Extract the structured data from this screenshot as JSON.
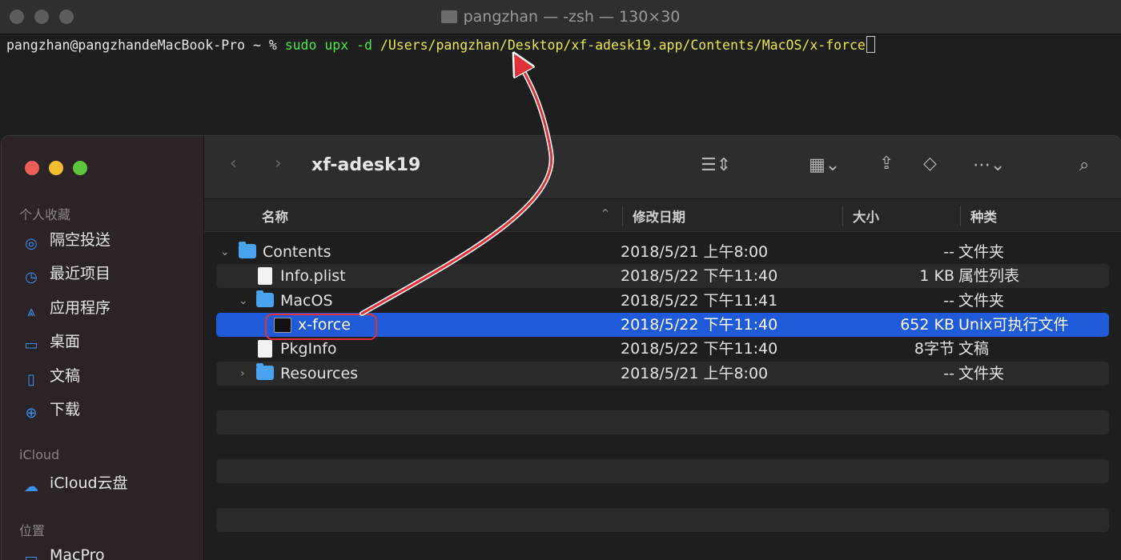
{
  "terminal": {
    "title": "pangzhan — -zsh — 130×30",
    "prompt": "pangzhan@pangzhandeMacBook-Pro ~ % ",
    "command": "sudo upx -d",
    "path": "/Users/pangzhan/Desktop/xf-adesk19.app/Contents/MacOS/x-force"
  },
  "finder": {
    "window_title": "xf-adesk19",
    "sidebar": {
      "sections": [
        {
          "label": "个人收藏",
          "items": [
            "隔空投送",
            "最近项目",
            "应用程序",
            "桌面",
            "文稿",
            "下载"
          ]
        },
        {
          "label": "iCloud",
          "items": [
            "iCloud云盘"
          ]
        },
        {
          "label": "位置",
          "items": [
            "MacPro"
          ]
        }
      ]
    },
    "columns": {
      "name": "名称",
      "date": "修改日期",
      "size": "大小",
      "kind": "种类"
    },
    "rows": [
      {
        "name": "Contents",
        "date": "2018/5/21 上午8:00",
        "size": "--",
        "kind": "文件夹"
      },
      {
        "name": "Info.plist",
        "date": "2018/5/22 下午11:40",
        "size": "1 KB",
        "kind": "属性列表"
      },
      {
        "name": "MacOS",
        "date": "2018/5/22 下午11:41",
        "size": "--",
        "kind": "文件夹"
      },
      {
        "name": "x-force",
        "date": "2018/5/22 下午11:40",
        "size": "652 KB",
        "kind": "Unix可执行文件"
      },
      {
        "name": "PkgInfo",
        "date": "2018/5/22 下午11:40",
        "size": "8字节",
        "kind": "文稿"
      },
      {
        "name": "Resources",
        "date": "2018/5/21 上午8:00",
        "size": "--",
        "kind": "文件夹"
      }
    ]
  },
  "colors": {
    "selection": "#1f5bd8",
    "annotation": "#e0303a",
    "terminal_green": "#4be84b",
    "terminal_yellow": "#e8e84b"
  }
}
